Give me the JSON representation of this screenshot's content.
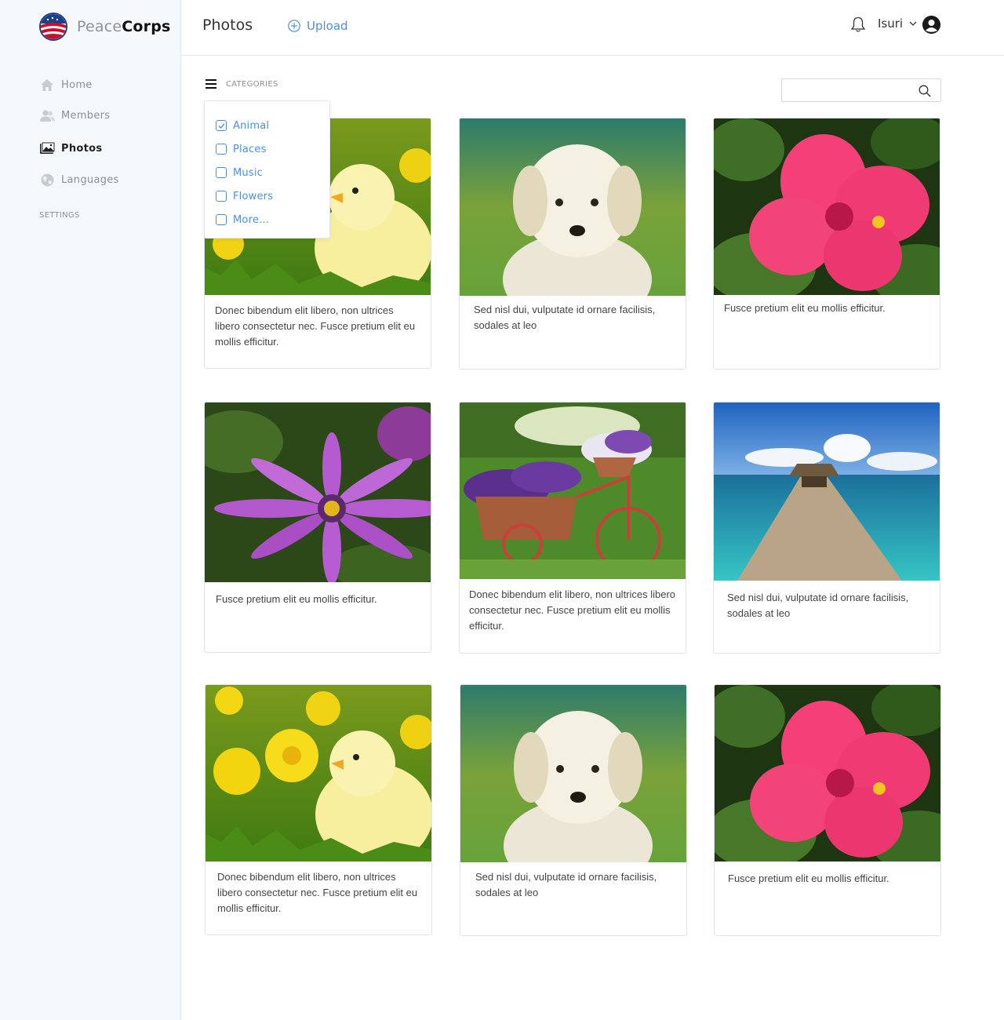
{
  "brand": {
    "name_light": "Peace",
    "name_bold": "Corps"
  },
  "sidebar": {
    "items": [
      {
        "label": "Home",
        "icon": "home-icon"
      },
      {
        "label": "Members",
        "icon": "members-icon"
      },
      {
        "label": "Photos",
        "icon": "photos-icon",
        "active": true
      },
      {
        "label": "Languages",
        "icon": "globe-icon"
      }
    ],
    "settings_label": "SETTINGS"
  },
  "header": {
    "title": "Photos",
    "upload_label": "Upload",
    "user_name": "Isuri"
  },
  "filter": {
    "categories_label": "CATEGORIES",
    "options": [
      {
        "label": "Animal",
        "checked": true
      },
      {
        "label": "Places",
        "checked": false
      },
      {
        "label": "Music",
        "checked": false
      },
      {
        "label": "Flowers",
        "checked": false
      },
      {
        "label": "More…",
        "checked": false
      }
    ]
  },
  "search": {
    "placeholder": ""
  },
  "photos": [
    {
      "subject": "chick",
      "caption": "Donec bibendum elit libero, non ultrices libero consectetur nec. Fusce pretium elit eu mollis efficitur."
    },
    {
      "subject": "puppy",
      "caption": "Sed nisl dui, vulputate id ornare facilisis, sodales at leo"
    },
    {
      "subject": "hibiscus",
      "caption": "Fusce pretium elit eu mollis efficitur."
    },
    {
      "subject": "daisy",
      "caption": "Fusce pretium elit eu mollis efficitur."
    },
    {
      "subject": "flower-cart",
      "caption": "Donec bibendum elit libero, non ultrices libero consectetur nec. Fusce pretium elit eu mollis efficitur."
    },
    {
      "subject": "pier",
      "caption": "Sed nisl dui, vulputate id ornare facilisis, sodales at leo"
    },
    {
      "subject": "chick",
      "caption": "Donec bibendum elit libero, non ultrices libero consectetur nec. Fusce pretium elit eu mollis efficitur."
    },
    {
      "subject": "puppy",
      "caption": "Sed nisl dui, vulputate id ornare facilisis, sodales at leo"
    },
    {
      "subject": "hibiscus",
      "caption": "Fusce pretium elit eu mollis efficitur."
    }
  ],
  "colors": {
    "accent": "#4a90e2",
    "sidebar_bg": "#f6f9fc"
  }
}
